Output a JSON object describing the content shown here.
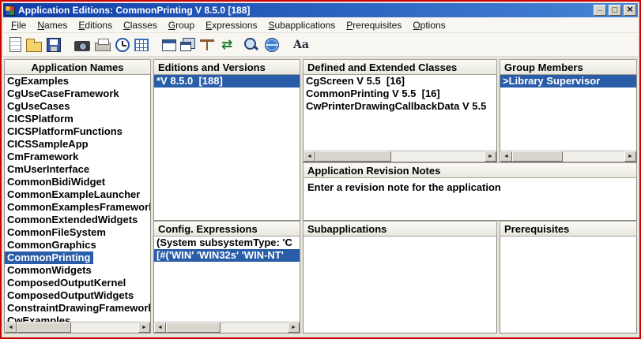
{
  "colors": {
    "window-border": "#cc0000",
    "titlebar-start": "#0f3ea8",
    "titlebar-end": "#4585d6",
    "selection": "#2a5da8",
    "list-bg": "#ffffff",
    "header-bg": "#fbfaf6"
  },
  "window": {
    "title": "Application Editions: CommonPrinting V 8.5.0  [188]"
  },
  "menubar": {
    "items": [
      "File",
      "Names",
      "Editions",
      "Classes",
      "Group",
      "Expressions",
      "Subapplications",
      "Prerequisites",
      "Options"
    ]
  },
  "toolbar": {
    "icons": [
      "new-icon",
      "open-icon",
      "save-icon",
      "camera-icon",
      "printer-icon",
      "clock-icon",
      "grid-icon",
      "window-icon",
      "cascade-icon",
      "scales-icon",
      "refresh-icon",
      "search-icon",
      "globe-icon",
      "font-icon"
    ]
  },
  "panes": {
    "app_names": {
      "header": "Application Names",
      "items": [
        "CgExamples",
        "CgUseCaseFramework",
        "CgUseCases",
        "CICSPlatform",
        "CICSPlatformFunctions",
        "CICSSampleApp",
        "CmFramework",
        "CmUserInterface",
        "CommonBidiWidget",
        "CommonExampleLauncher",
        "CommonExamplesFramework",
        "CommonExtendedWidgets",
        "CommonFileSystem",
        "CommonGraphics",
        "CommonPrinting",
        "CommonWidgets",
        "ComposedOutputKernel",
        "ComposedOutputWidgets",
        "ConstraintDrawingFramework",
        "CwExamples"
      ],
      "selected": "CommonPrinting"
    },
    "editions": {
      "header": "Editions and Versions",
      "items": [
        "*V 8.5.0  [188]"
      ],
      "selected": "*V 8.5.0  [188]"
    },
    "classes": {
      "header": "Defined and Extended Classes",
      "items": [
        "CgScreen V 5.5  [16]",
        "CommonPrinting V 5.5  [16]",
        "CwPrinterDrawingCallbackData V 5.5"
      ]
    },
    "group_members": {
      "header": "Group Members",
      "items": [
        ">Library Supervisor"
      ],
      "selected": ">Library Supervisor"
    },
    "revision_notes": {
      "header": "Application Revision Notes",
      "text": "Enter a revision note for the application"
    },
    "config_expressions": {
      "header": "Config. Expressions",
      "items": [
        "(System subsystemType: 'C",
        "[#('WIN' 'WIN32s' 'WIN-NT'"
      ],
      "selected": "[#('WIN' 'WIN32s' 'WIN-NT'"
    },
    "subapplications": {
      "header": "Subapplications",
      "items": []
    },
    "prerequisites": {
      "header": "Prerequisites",
      "items": []
    }
  }
}
